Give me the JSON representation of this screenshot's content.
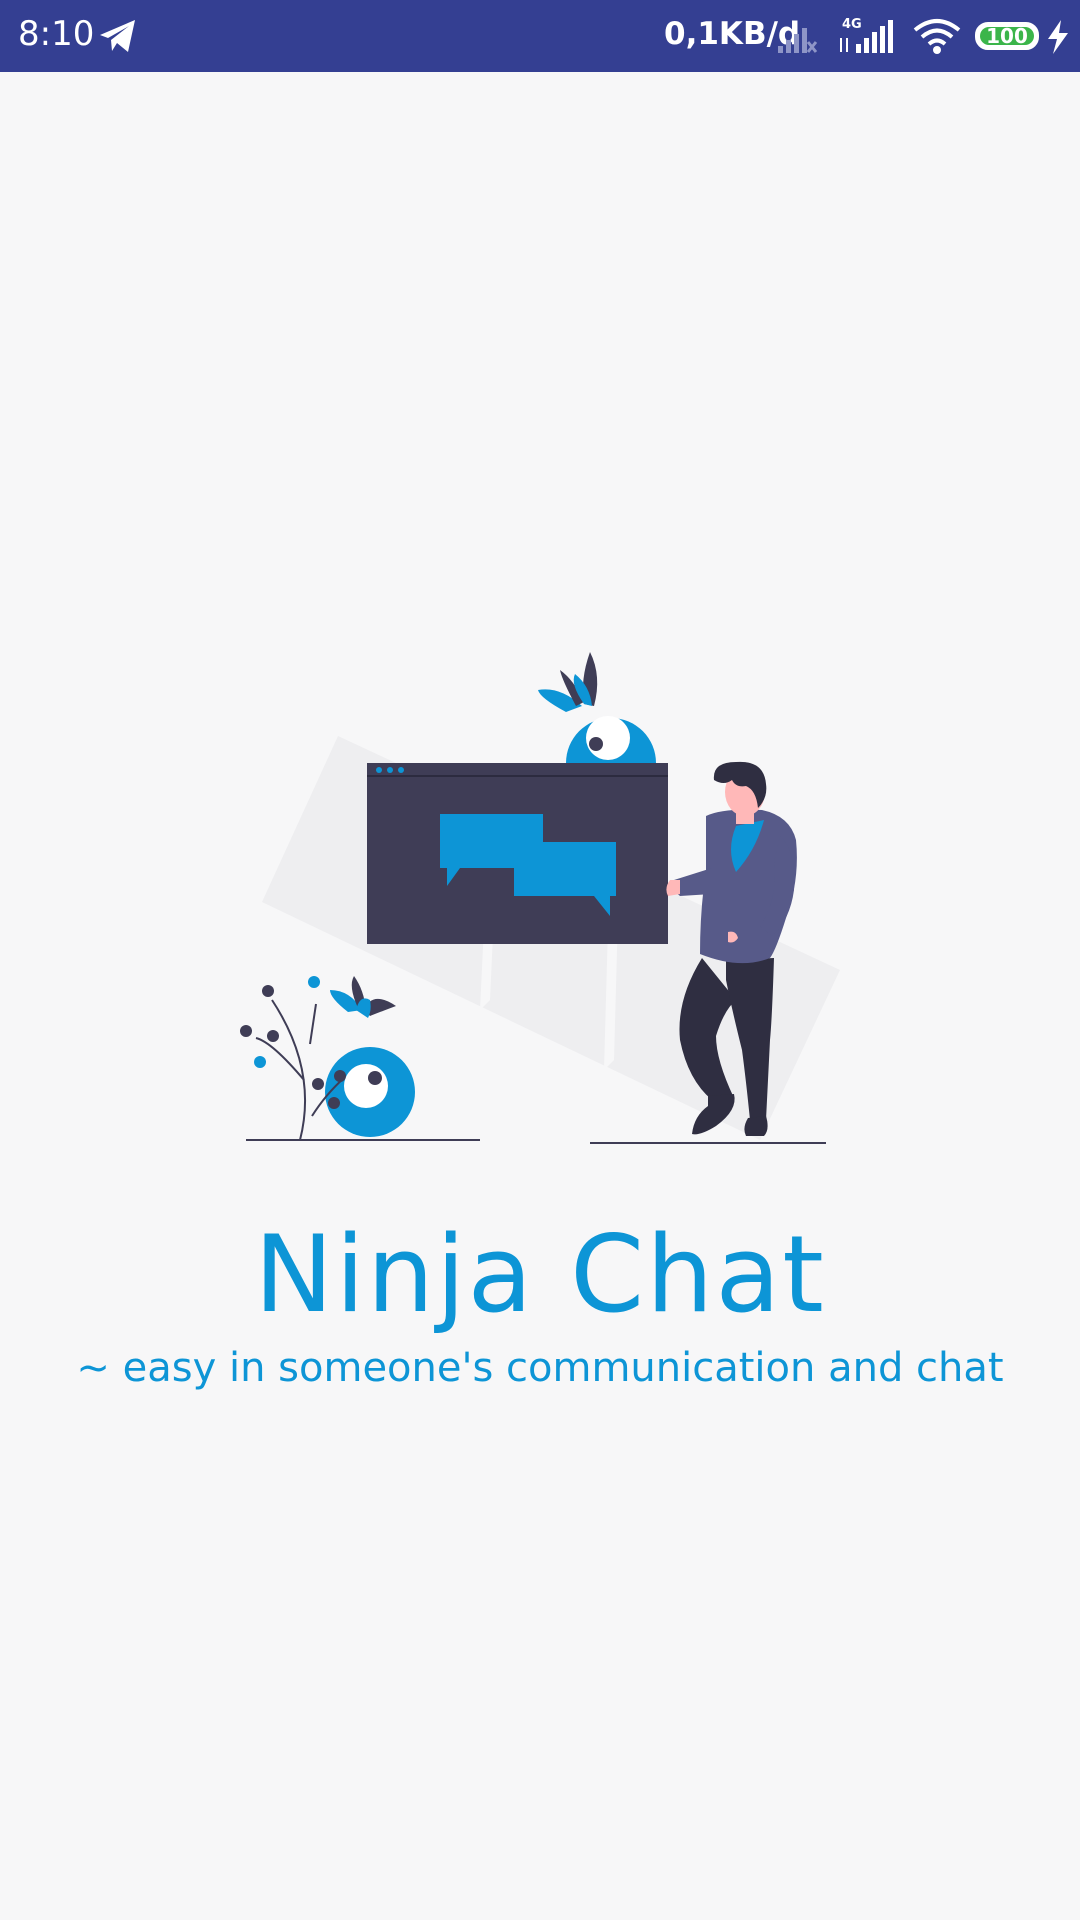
{
  "status_bar": {
    "time": "8:10",
    "network_speed": "0,1KB/d",
    "network_type": "4G",
    "battery_level": "100",
    "icons": [
      "telegram-icon",
      "signal-empty-icon",
      "signal-4g-icon",
      "wifi-icon",
      "battery-icon",
      "charging-icon"
    ]
  },
  "splash": {
    "title": "Ninja Chat",
    "subtitle": "~ easy in someone's communication and chat"
  },
  "colors": {
    "status_bar": "#343f92",
    "accent": "#0d95d6",
    "background": "#f7f7f8",
    "dark": "#3f3d56",
    "battery_green": "#3bb54a"
  }
}
